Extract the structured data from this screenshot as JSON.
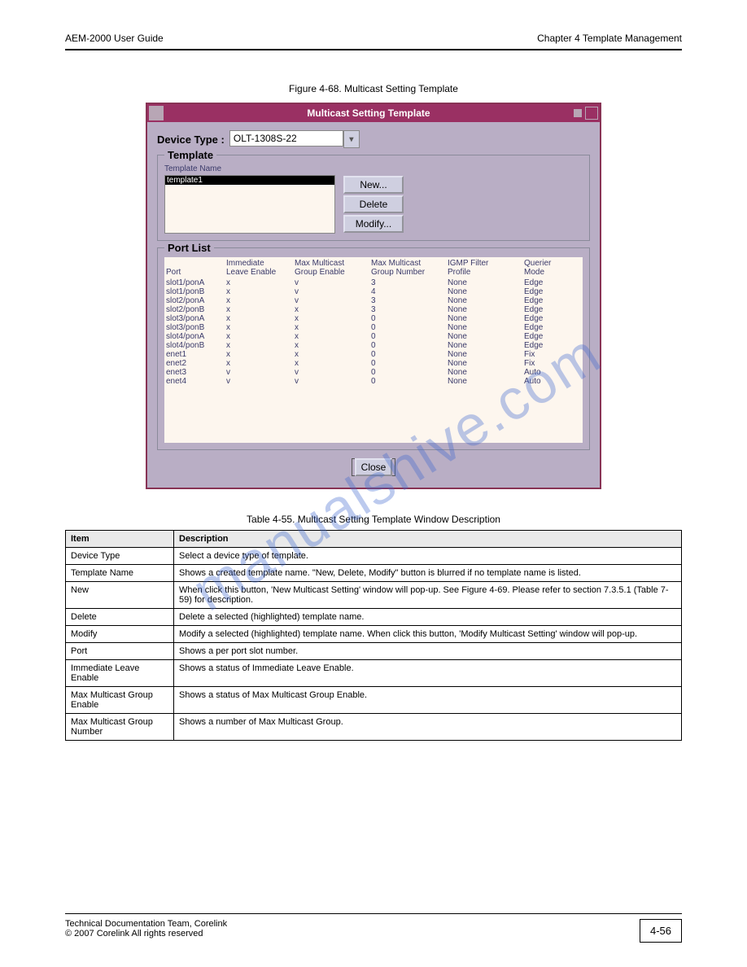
{
  "header": {
    "left": "AEM-2000 User Guide",
    "right": "Chapter 4 Template Management"
  },
  "fig_caption": "Figure 4-68. Multicast Setting Template",
  "app": {
    "title": "Multicast Setting Template",
    "device_label": "Device Type :",
    "device_value": "OLT-1308S-22",
    "template_group": "Template",
    "template_name_lbl": "Template Name",
    "template_selected": "template1",
    "buttons": {
      "new": "New...",
      "delete": "Delete",
      "modify": "Modify..."
    },
    "portlist_group": "Port List",
    "columns": {
      "port": "Port",
      "imm1": "Immediate",
      "imm2": "Leave Enable",
      "mge1": "Max Multicast",
      "mge2": "Group Enable",
      "mgn1": "Max Multicast",
      "mgn2": "Group Number",
      "igmp1": "IGMP Filter",
      "igmp2": "Profile",
      "q1": "Querier",
      "q2": "Mode"
    },
    "rows": [
      {
        "port": "slot1/ponA",
        "imm": "x",
        "mge": "v",
        "mgn": "3",
        "igmp": "None",
        "q": "Edge"
      },
      {
        "port": "slot1/ponB",
        "imm": "x",
        "mge": "v",
        "mgn": "4",
        "igmp": "None",
        "q": "Edge"
      },
      {
        "port": "slot2/ponA",
        "imm": "x",
        "mge": "v",
        "mgn": "3",
        "igmp": "None",
        "q": "Edge"
      },
      {
        "port": "slot2/ponB",
        "imm": "x",
        "mge": "x",
        "mgn": "3",
        "igmp": "None",
        "q": "Edge"
      },
      {
        "port": "slot3/ponA",
        "imm": "x",
        "mge": "x",
        "mgn": "0",
        "igmp": "None",
        "q": "Edge"
      },
      {
        "port": "slot3/ponB",
        "imm": "x",
        "mge": "x",
        "mgn": "0",
        "igmp": "None",
        "q": "Edge"
      },
      {
        "port": "slot4/ponA",
        "imm": "x",
        "mge": "x",
        "mgn": "0",
        "igmp": "None",
        "q": "Edge"
      },
      {
        "port": "slot4/ponB",
        "imm": "x",
        "mge": "x",
        "mgn": "0",
        "igmp": "None",
        "q": "Edge"
      },
      {
        "port": "enet1",
        "imm": "x",
        "mge": "x",
        "mgn": "0",
        "igmp": "None",
        "q": "Fix"
      },
      {
        "port": "enet2",
        "imm": "x",
        "mge": "x",
        "mgn": "0",
        "igmp": "None",
        "q": "Fix"
      },
      {
        "port": "enet3",
        "imm": "v",
        "mge": "v",
        "mgn": "0",
        "igmp": "None",
        "q": "Auto"
      },
      {
        "port": "enet4",
        "imm": "v",
        "mge": "v",
        "mgn": "0",
        "igmp": "None",
        "q": "Auto"
      }
    ],
    "close": "Close"
  },
  "watermark": "manualshive.com",
  "tbl_caption": "Table 4-55. Multicast Setting Template Window Description",
  "tbl_head": {
    "item": "Item",
    "desc": "Description"
  },
  "tbl_rows": [
    {
      "item": "Device Type",
      "desc": "Select a device type of template."
    },
    {
      "item": "Template Name",
      "desc": "Shows a created template name. \"New, Delete, Modify\" button is blurred if no template name is listed."
    },
    {
      "item": "New",
      "desc": "When click this button, 'New Multicast Setting' window will pop-up. See Figure 4-69. Please refer to section 7.3.5.1 (Table 7-59) for description."
    },
    {
      "item": "Delete",
      "desc": "Delete a selected (highlighted) template name."
    },
    {
      "item": "Modify",
      "desc": "Modify a selected (highlighted) template name. When click this button, 'Modify Multicast Setting' window will pop-up."
    },
    {
      "item": "Port",
      "desc": "Shows a per port slot number."
    },
    {
      "item": "Immediate Leave Enable",
      "desc": "Shows a status of Immediate Leave Enable."
    },
    {
      "item": "Max Multicast Group Enable",
      "desc": "Shows a status of Max Multicast Group Enable."
    },
    {
      "item": "Max Multicast Group Number",
      "desc": "Shows a number of Max Multicast Group."
    }
  ],
  "footer": {
    "left1": "Technical Documentation Team, Corelink",
    "left2": "© 2007 Corelink  All rights reserved",
    "page": "4-56"
  }
}
